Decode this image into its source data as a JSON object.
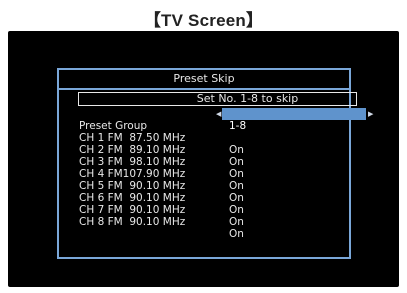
{
  "caption": "【TV Screen】",
  "dialog": {
    "title": "Preset Skip",
    "hint": "Set No. 1-8 to skip",
    "preset_group": {
      "label": "Preset Group",
      "value": "1-8"
    },
    "channels": [
      {
        "label": "CH 1 FM  87.50 MHz",
        "value": "On"
      },
      {
        "label": "CH 2 FM  89.10 MHz",
        "value": "On"
      },
      {
        "label": "CH 3 FM  98.10 MHz",
        "value": "On"
      },
      {
        "label": "CH 4 FM107.90 MHz",
        "value": "On"
      },
      {
        "label": "CH 5 FM  90.10 MHz",
        "value": "On"
      },
      {
        "label": "CH 6 FM  90.10 MHz",
        "value": "On"
      },
      {
        "label": "CH 7 FM  90.10 MHz",
        "value": "On"
      },
      {
        "label": "CH 8 FM  90.10 MHz",
        "value": "On"
      }
    ]
  }
}
